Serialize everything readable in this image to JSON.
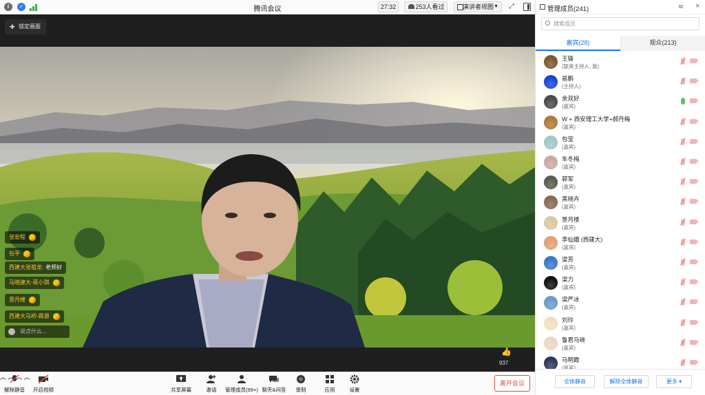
{
  "titlebar": {
    "app_title": "腾讯会议",
    "timer": "27:32",
    "viewers": "253人看过",
    "layout": "演讲者视图"
  },
  "video": {
    "lock_label": "锁定画面",
    "chat": [
      {
        "name": "张宏程",
        "msg": "",
        "clap": true
      },
      {
        "name": "包平",
        "msg": "",
        "clap": true
      },
      {
        "name": "西建大张祖龙",
        "msg": "老师好",
        "clap": false
      },
      {
        "name": "马晓建大-蒋小琪",
        "msg": "",
        "clap": true
      },
      {
        "name": "垦月楼",
        "msg": "",
        "clap": true
      },
      {
        "name": "西建大马桥-霖源",
        "msg": "",
        "clap": true
      }
    ],
    "chat_placeholder": "说点什么...",
    "likes": "937"
  },
  "toolbar": {
    "mute": "解除静音",
    "video": "开启视频",
    "share": "共享屏幕",
    "invite": "邀请",
    "members": "管理成员(99+)",
    "chat": "聊天&问答",
    "record": "录制",
    "apps": "应用",
    "settings": "设置",
    "leave": "离开会议"
  },
  "panel": {
    "title": "管理成员(241)",
    "search_placeholder": "搜索成员",
    "tab_guests": "嘉宾(28)",
    "tab_audience": "观众(213)",
    "members": [
      {
        "name": "王锋",
        "role": "(联席主持人, 我)",
        "mic": "off",
        "avatar": "#7a5a2e"
      },
      {
        "name": "易鹏",
        "role": "(主持人)",
        "mic": "off",
        "avatar": "#1746d8"
      },
      {
        "name": "余双好",
        "role": "(嘉宾)",
        "mic": "on",
        "avatar": "#4a4a4a"
      },
      {
        "name": "W + 西安理工大学+郝丹梅",
        "role": "(嘉宾)",
        "mic": "off",
        "avatar": "#b07a3a"
      },
      {
        "name": "包莹",
        "role": "(嘉宾)",
        "mic": "off",
        "avatar": "#9ec7c7"
      },
      {
        "name": "车冬梅",
        "role": "(嘉宾)",
        "mic": "off",
        "avatar": "#c9a9a0"
      },
      {
        "name": "郭军",
        "role": "(嘉宾)",
        "mic": "off",
        "avatar": "#5c5c4c"
      },
      {
        "name": "黑晓卉",
        "role": "(嘉宾)",
        "mic": "off",
        "avatar": "#8a6a52"
      },
      {
        "name": "垦月楼",
        "role": "(嘉宾)",
        "mic": "off",
        "avatar": "#d9c9a0"
      },
      {
        "name": "李仙娥 (西建大)",
        "role": "(嘉宾)",
        "mic": "off",
        "avatar": "#e0a070"
      },
      {
        "name": "梁芳",
        "role": "(嘉宾)",
        "mic": "off",
        "avatar": "#3a78c8"
      },
      {
        "name": "梁力",
        "role": "(嘉宾)",
        "mic": "off",
        "avatar": "#111111"
      },
      {
        "name": "梁严冰",
        "role": "(嘉宾)",
        "mic": "off",
        "avatar": "#6a9acb"
      },
      {
        "name": "刘玲",
        "role": "(嘉宾)",
        "mic": "off",
        "avatar": "#f0e0c0"
      },
      {
        "name": "鲁君马晓",
        "role": "(嘉宾)",
        "mic": "off",
        "avatar": "#e8d8c0"
      },
      {
        "name": "马明霞",
        "role": "(嘉宾)",
        "mic": "off",
        "avatar": "#2d3a5a"
      }
    ],
    "mute_all": "全体静音",
    "unmute_all": "解除全体静音",
    "more": "更多 ▾"
  }
}
